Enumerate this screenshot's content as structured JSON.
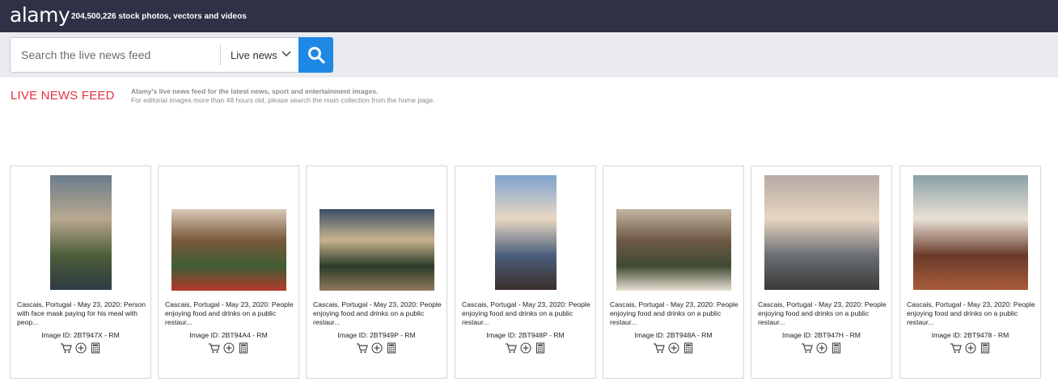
{
  "header": {
    "logo": "alamy",
    "tagline": "204,500,226  stock photos, vectors and videos"
  },
  "search": {
    "placeholder": "Search the live news feed",
    "scope": "Live news"
  },
  "intro": {
    "title": "LIVE NEWS FEED",
    "line1": "Alamy's live news feed for the latest news, sport and entertainment images.",
    "line2": "For editorial images more than 48 hours old, please search the main collection from the home page."
  },
  "colors": {
    "topbar": "#2f3246",
    "accent": "#1e88e5",
    "title_red": "#e8323c"
  },
  "results": [
    {
      "caption": "Cascais, Portugal - May 23, 2020: Person with face mask paying for his meal with peop...",
      "image_id": "Image ID: 2BT947X - RM",
      "orientation": "portrait"
    },
    {
      "caption": "Cascais, Portugal - May 23, 2020: People enjoying food and drinks on a public restaur...",
      "image_id": "Image ID: 2BT94A4 - RM",
      "orientation": "landscape"
    },
    {
      "caption": "Cascais, Portugal - May 23, 2020: People enjoying food and drinks on a public restaur...",
      "image_id": "Image ID: 2BT949P - RM",
      "orientation": "landscape"
    },
    {
      "caption": "Cascais, Portugal - May 23, 2020: People enjoying food and drinks on a public restaur...",
      "image_id": "Image ID: 2BT948P - RM",
      "orientation": "portrait"
    },
    {
      "caption": "Cascais, Portugal - May 23, 2020: People enjoying food and drinks on a public restaur...",
      "image_id": "Image ID: 2BT948A - RM",
      "orientation": "landscape"
    },
    {
      "caption": "Cascais, Portugal - May 23, 2020: People enjoying food and drinks on a public restaur...",
      "image_id": "Image ID: 2BT947H - RM",
      "orientation": "landscape-tall"
    },
    {
      "caption": "Cascais, Portugal - May 23, 2020: People enjoying food and drinks on a public restaur...",
      "image_id": "Image ID: 2BT9478 - RM",
      "orientation": "landscape-tall"
    }
  ],
  "card_actions": [
    "cart-icon",
    "add-to-lightbox-icon",
    "price-calculator-icon"
  ]
}
